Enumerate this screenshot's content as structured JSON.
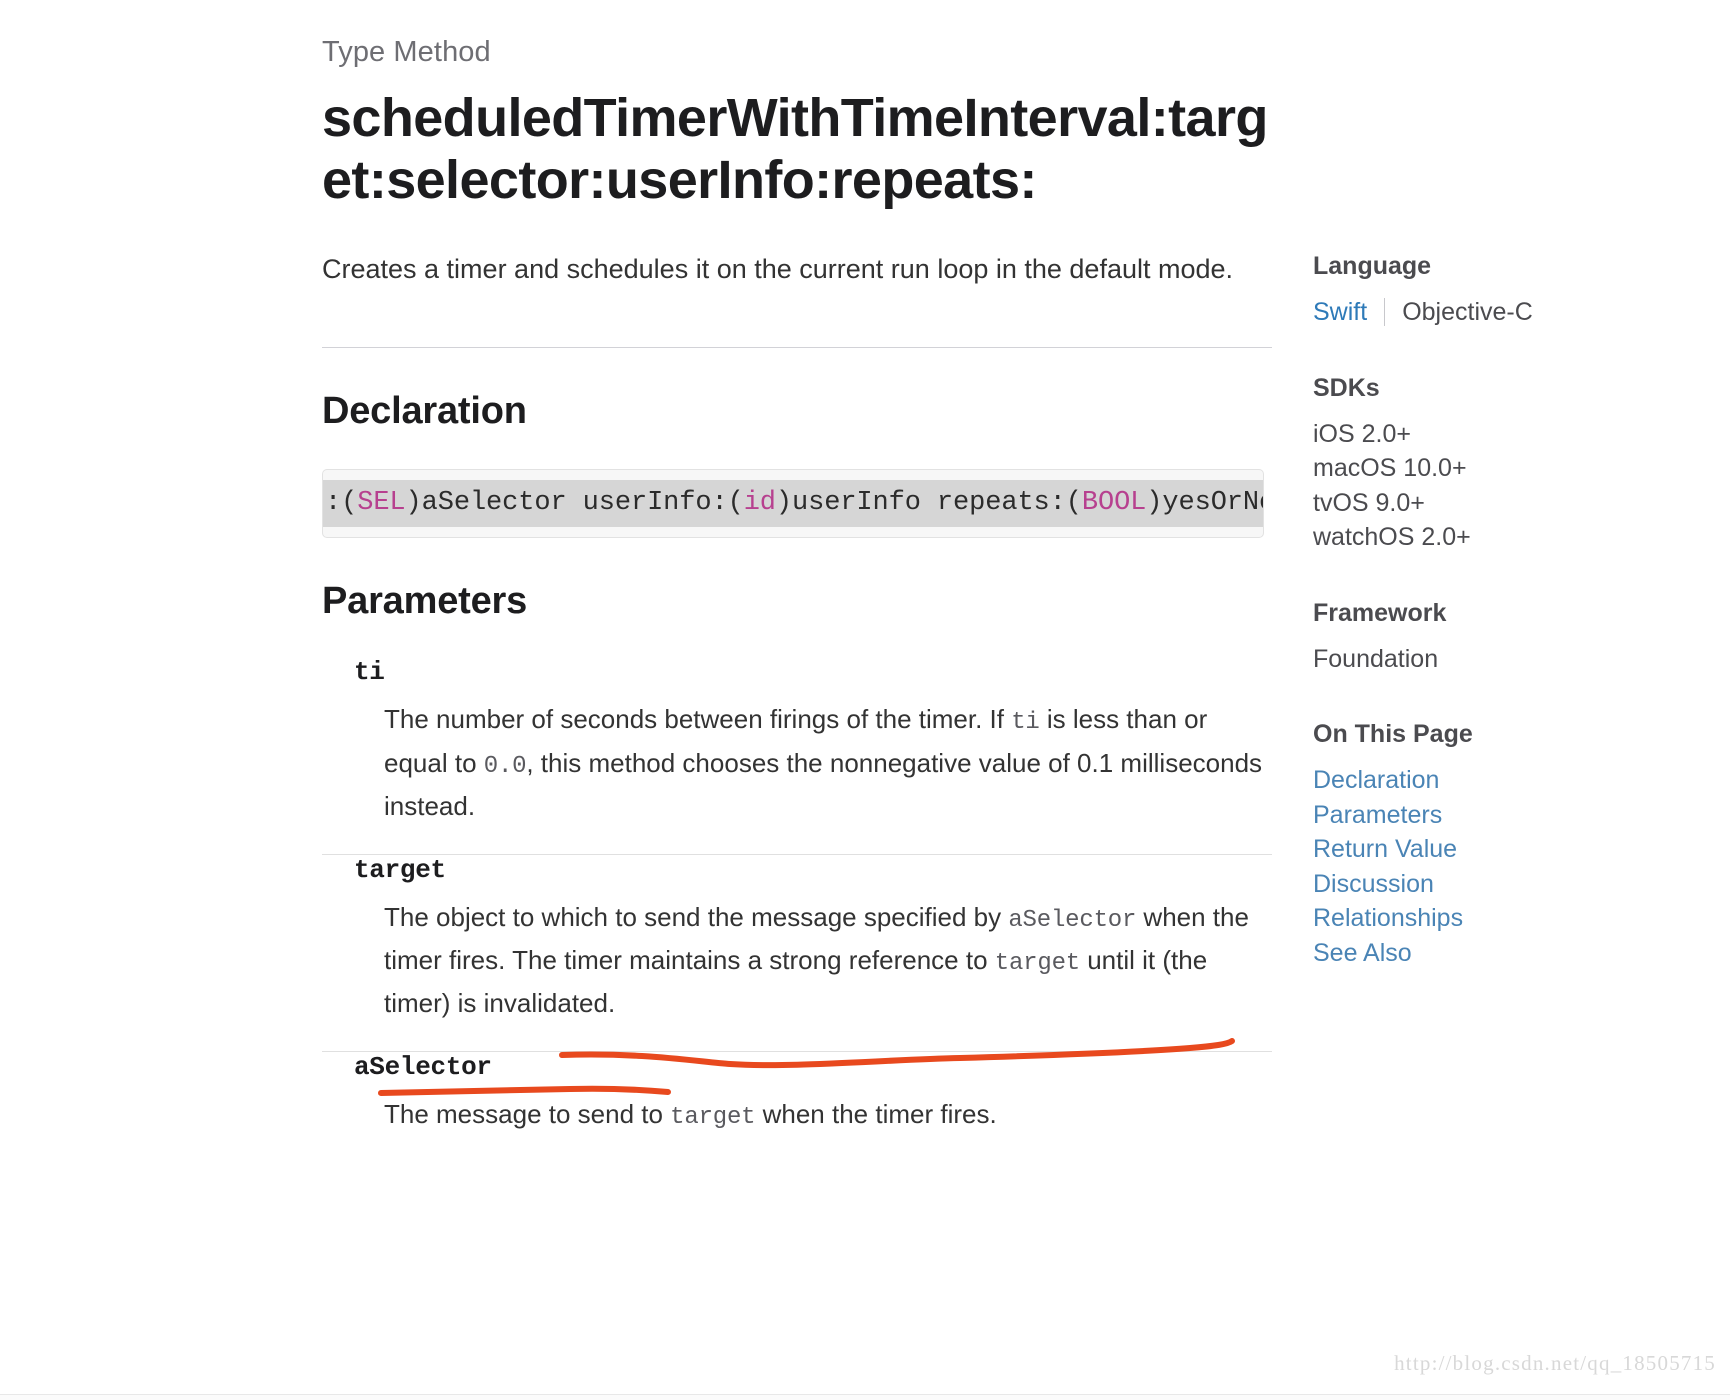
{
  "article": {
    "eyebrow": "Type Method",
    "title": "scheduledTimerWithTimeInterval:target:selector:userInfo:repeats:",
    "abstract": "Creates a timer and schedules it on the current run loop in the default mode."
  },
  "declaration": {
    "heading": "Declaration",
    "code_segments": [
      {
        "text": ":(",
        "type": "plain"
      },
      {
        "text": "SEL",
        "type": "type"
      },
      {
        "text": ")aSelector userInfo:(",
        "type": "plain"
      },
      {
        "text": "id",
        "type": "type"
      },
      {
        "text": ")userInfo repeats:(",
        "type": "plain"
      },
      {
        "text": "BOOL",
        "type": "type"
      },
      {
        "text": ")yesOrNo;",
        "type": "plain"
      }
    ],
    "code_text": ":(SEL)aSelector userInfo:(id)userInfo repeats:(BOOL)yesOrNo;"
  },
  "parameters": {
    "heading": "Parameters",
    "items": [
      {
        "name": "ti",
        "desc_parts": [
          {
            "text": "The number of seconds between firings of the timer. If ",
            "code": false
          },
          {
            "text": "ti",
            "code": true
          },
          {
            "text": " is less than or equal to ",
            "code": false
          },
          {
            "text": "0.0",
            "code": true
          },
          {
            "text": ", this method chooses the nonnegative value of 0.1 milliseconds instead.",
            "code": false
          }
        ]
      },
      {
        "name": "target",
        "desc_parts": [
          {
            "text": "The object to which to send the message specified by ",
            "code": false
          },
          {
            "text": "aSelector",
            "code": true
          },
          {
            "text": " when the timer fires. The timer maintains a strong reference to ",
            "code": false
          },
          {
            "text": "target",
            "code": true
          },
          {
            "text": " until it (the timer) is invalidated.",
            "code": false
          }
        ]
      },
      {
        "name": "aSelector",
        "desc_parts": [
          {
            "text": "The message to send to ",
            "code": false
          },
          {
            "text": "target",
            "code": true
          },
          {
            "text": " when the timer fires.",
            "code": false
          }
        ]
      }
    ]
  },
  "sidebar": {
    "language": {
      "heading": "Language",
      "selected": "Swift",
      "other": "Objective-C"
    },
    "sdks": {
      "heading": "SDKs",
      "items": [
        "iOS 2.0+",
        "macOS 10.0+",
        "tvOS 9.0+",
        "watchOS 2.0+"
      ]
    },
    "framework": {
      "heading": "Framework",
      "value": "Foundation"
    },
    "on_this_page": {
      "heading": "On This Page",
      "links": [
        "Declaration",
        "Parameters",
        "Return Value",
        "Discussion",
        "Relationships",
        "See Also"
      ]
    }
  },
  "annotation": {
    "color": "#E8491E",
    "note": "hand-drawn red underlines on the target parameter sentence"
  },
  "watermark": {
    "text": "http://blog.csdn.net/qq_18505715"
  },
  "colors": {
    "link": "#4a84b5",
    "lang_active": "#2e7ab8",
    "code_keyword": "#b7408f",
    "code_band": "#d6d6d6",
    "annotation_red": "#E8491E"
  }
}
